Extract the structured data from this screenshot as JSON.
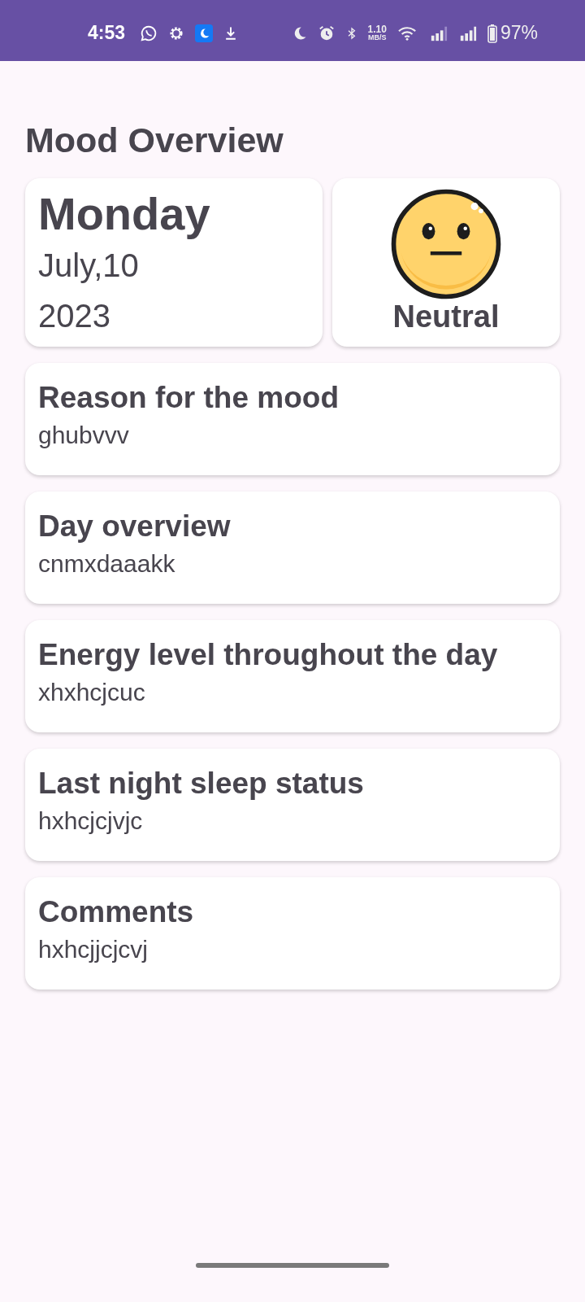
{
  "status_bar": {
    "time": "4:53",
    "speed_value": "1.10",
    "speed_unit": "MB/S",
    "battery": "97%"
  },
  "title": "Mood Overview",
  "date": {
    "weekday": "Monday",
    "month_day": "July,10",
    "year": "2023"
  },
  "mood": {
    "kind": "neutral",
    "label": "Neutral"
  },
  "entries": [
    {
      "title": "Reason for the mood",
      "value": "ghubvvv"
    },
    {
      "title": "Day overview",
      "value": "cnmxdaaakk"
    },
    {
      "title": "Energy level throughout the day",
      "value": "xhxhcjcuc"
    },
    {
      "title": "Last night sleep status",
      "value": "hxhcjcjvjc"
    },
    {
      "title": "Comments",
      "value": "hxhcjjcjcvj"
    }
  ]
}
